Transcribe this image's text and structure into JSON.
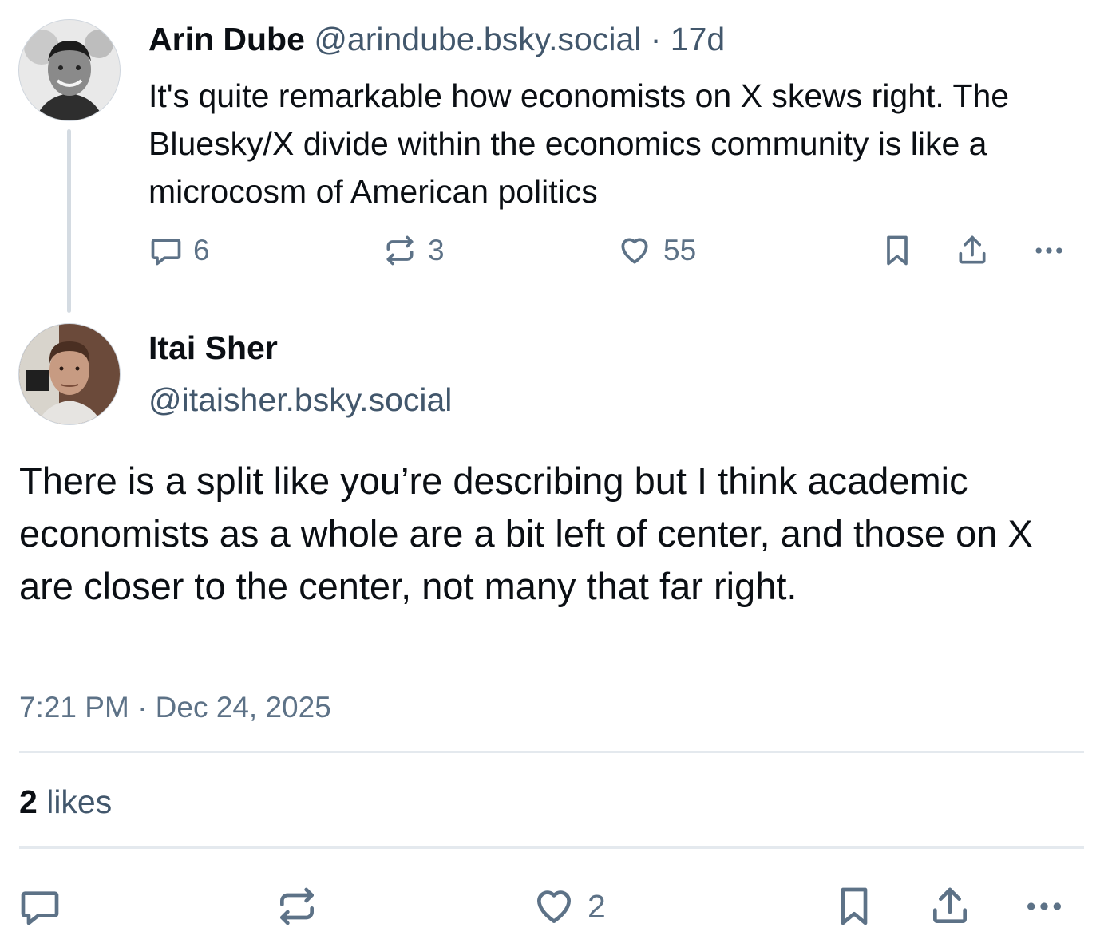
{
  "parent_post": {
    "author_name": "Arin Dube",
    "handle_time": "@arindube.bsky.social · 17d",
    "text": "It's quite remarkable how economists on X skews right. The Bluesky/X divide within the economics community is like a microcosm of American politics",
    "replies": "6",
    "reposts": "3",
    "likes": "55"
  },
  "reply_post": {
    "author_name": "Itai Sher",
    "handle": "@itaisher.bsky.social",
    "text": "There is a split like you’re describing but I think academic economists as a whole are a bit left of center, and those on X are closer to the center, not many that far right.",
    "timestamp": "7:21 PM · Dec 24, 2025",
    "like_count": "2",
    "like_word": "likes",
    "action_like_count": "2"
  },
  "icons": {
    "reply": "reply-icon",
    "repost": "repost-icon",
    "like": "heart-icon",
    "bookmark": "bookmark-icon",
    "share": "share-icon",
    "more": "more-icon"
  },
  "colors": {
    "text": "#0b0f14",
    "muted_text": "#42576c",
    "icon": "#5d7287",
    "divider": "#e4e9ee"
  }
}
